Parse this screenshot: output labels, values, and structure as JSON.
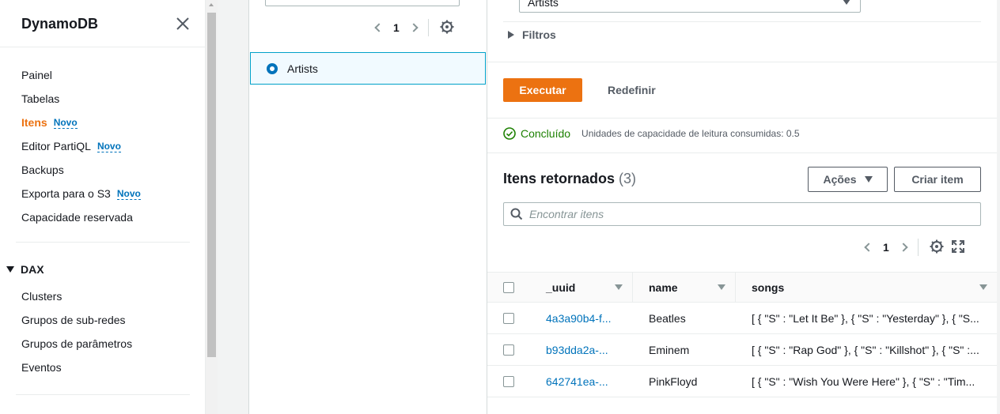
{
  "sidebar": {
    "title": "DynamoDB",
    "items": [
      {
        "label": "Painel"
      },
      {
        "label": "Tabelas"
      },
      {
        "label": "Itens",
        "badge": "Novo"
      },
      {
        "label": "Editor PartiQL",
        "badge": "Novo"
      },
      {
        "label": "Backups"
      },
      {
        "label": "Exporta para o S3",
        "badge": "Novo"
      },
      {
        "label": "Capacidade reservada"
      }
    ],
    "dax": {
      "label": "DAX",
      "items": [
        {
          "label": "Clusters"
        },
        {
          "label": "Grupos de sub-redes"
        },
        {
          "label": "Grupos de parâmetros"
        },
        {
          "label": "Eventos"
        }
      ]
    }
  },
  "table_list": {
    "page": "1",
    "selected_table": "Artists"
  },
  "query": {
    "selected_table": "Artists",
    "filters_label": "Filtros",
    "run_label": "Executar",
    "reset_label": "Redefinir",
    "status": "Concluído",
    "status_note": "Unidades de capacidade de leitura consumidas: 0.5"
  },
  "results": {
    "title": "Itens retornados",
    "count": "(3)",
    "actions_label": "Ações",
    "create_label": "Criar item",
    "search_placeholder": "Encontrar itens",
    "page": "1",
    "columns": [
      "_uuid",
      "name",
      "songs"
    ],
    "rows": [
      {
        "uuid": "4a3a90b4-f...",
        "name": "Beatles",
        "songs": "[ { \"S\" : \"Let It Be\" }, { \"S\" : \"Yesterday\" }, { \"S..."
      },
      {
        "uuid": "b93dda2a-...",
        "name": "Eminem",
        "songs": "[ { \"S\" : \"Rap God\" }, { \"S\" : \"Killshot\" }, { \"S\" :..."
      },
      {
        "uuid": "642741ea-...",
        "name": "PinkFloyd",
        "songs": "[ { \"S\" : \"Wish You Were Here\" }, { \"S\" : \"Tim..."
      }
    ]
  },
  "colors": {
    "accent": "#ec7211",
    "link": "#0073bb",
    "success": "#1d8102"
  }
}
